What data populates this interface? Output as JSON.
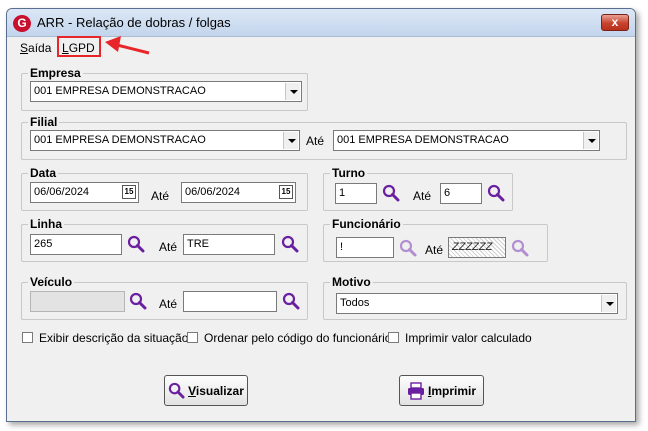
{
  "window": {
    "title": "ARR - Relação de dobras / folgas",
    "icon_letter": "G",
    "close_label": "x"
  },
  "menu": {
    "saida_first": "S",
    "saida_rest": "aída",
    "lgpd_first": "L",
    "lgpd_rest": "GPD"
  },
  "empresa": {
    "legend": "Empresa",
    "value": "001 EMPRESA DEMONSTRACAO"
  },
  "filial": {
    "legend": "Filial",
    "from": "001 EMPRESA DEMONSTRACAO",
    "ate_label": "Até",
    "to": "001 EMPRESA DEMONSTRACAO"
  },
  "data": {
    "legend": "Data",
    "from": "06/06/2024",
    "ate_label": "Até",
    "to": "06/06/2024",
    "calendar_label": "15"
  },
  "turno": {
    "legend": "Turno",
    "from": "1",
    "ate_label": "Até",
    "to": "6"
  },
  "linha": {
    "legend": "Linha",
    "from": "265",
    "ate_label": "Até",
    "to": "TRE"
  },
  "funcionario": {
    "legend": "Funcionário",
    "from": "!",
    "ate_label": "Até",
    "to": "ZZZZZZ"
  },
  "veiculo": {
    "legend": "Veículo",
    "from": "",
    "ate_label": "Até",
    "to": ""
  },
  "motivo": {
    "legend": "Motivo",
    "value": "Todos"
  },
  "options": {
    "exibir": "Exibir descrição da situação",
    "ordenar": "Ordenar pelo código do funcionário",
    "imprimir_valor": "Imprimir valor calculado"
  },
  "buttons": {
    "visualizar_first": "V",
    "visualizar_rest": "isualizar",
    "imprimir_first": "I",
    "imprimir_rest": "mprimir"
  },
  "colors": {
    "accent_search": "#6a1fa0",
    "search_disabled": "#b48fd0",
    "annotation": "#e8262a"
  }
}
